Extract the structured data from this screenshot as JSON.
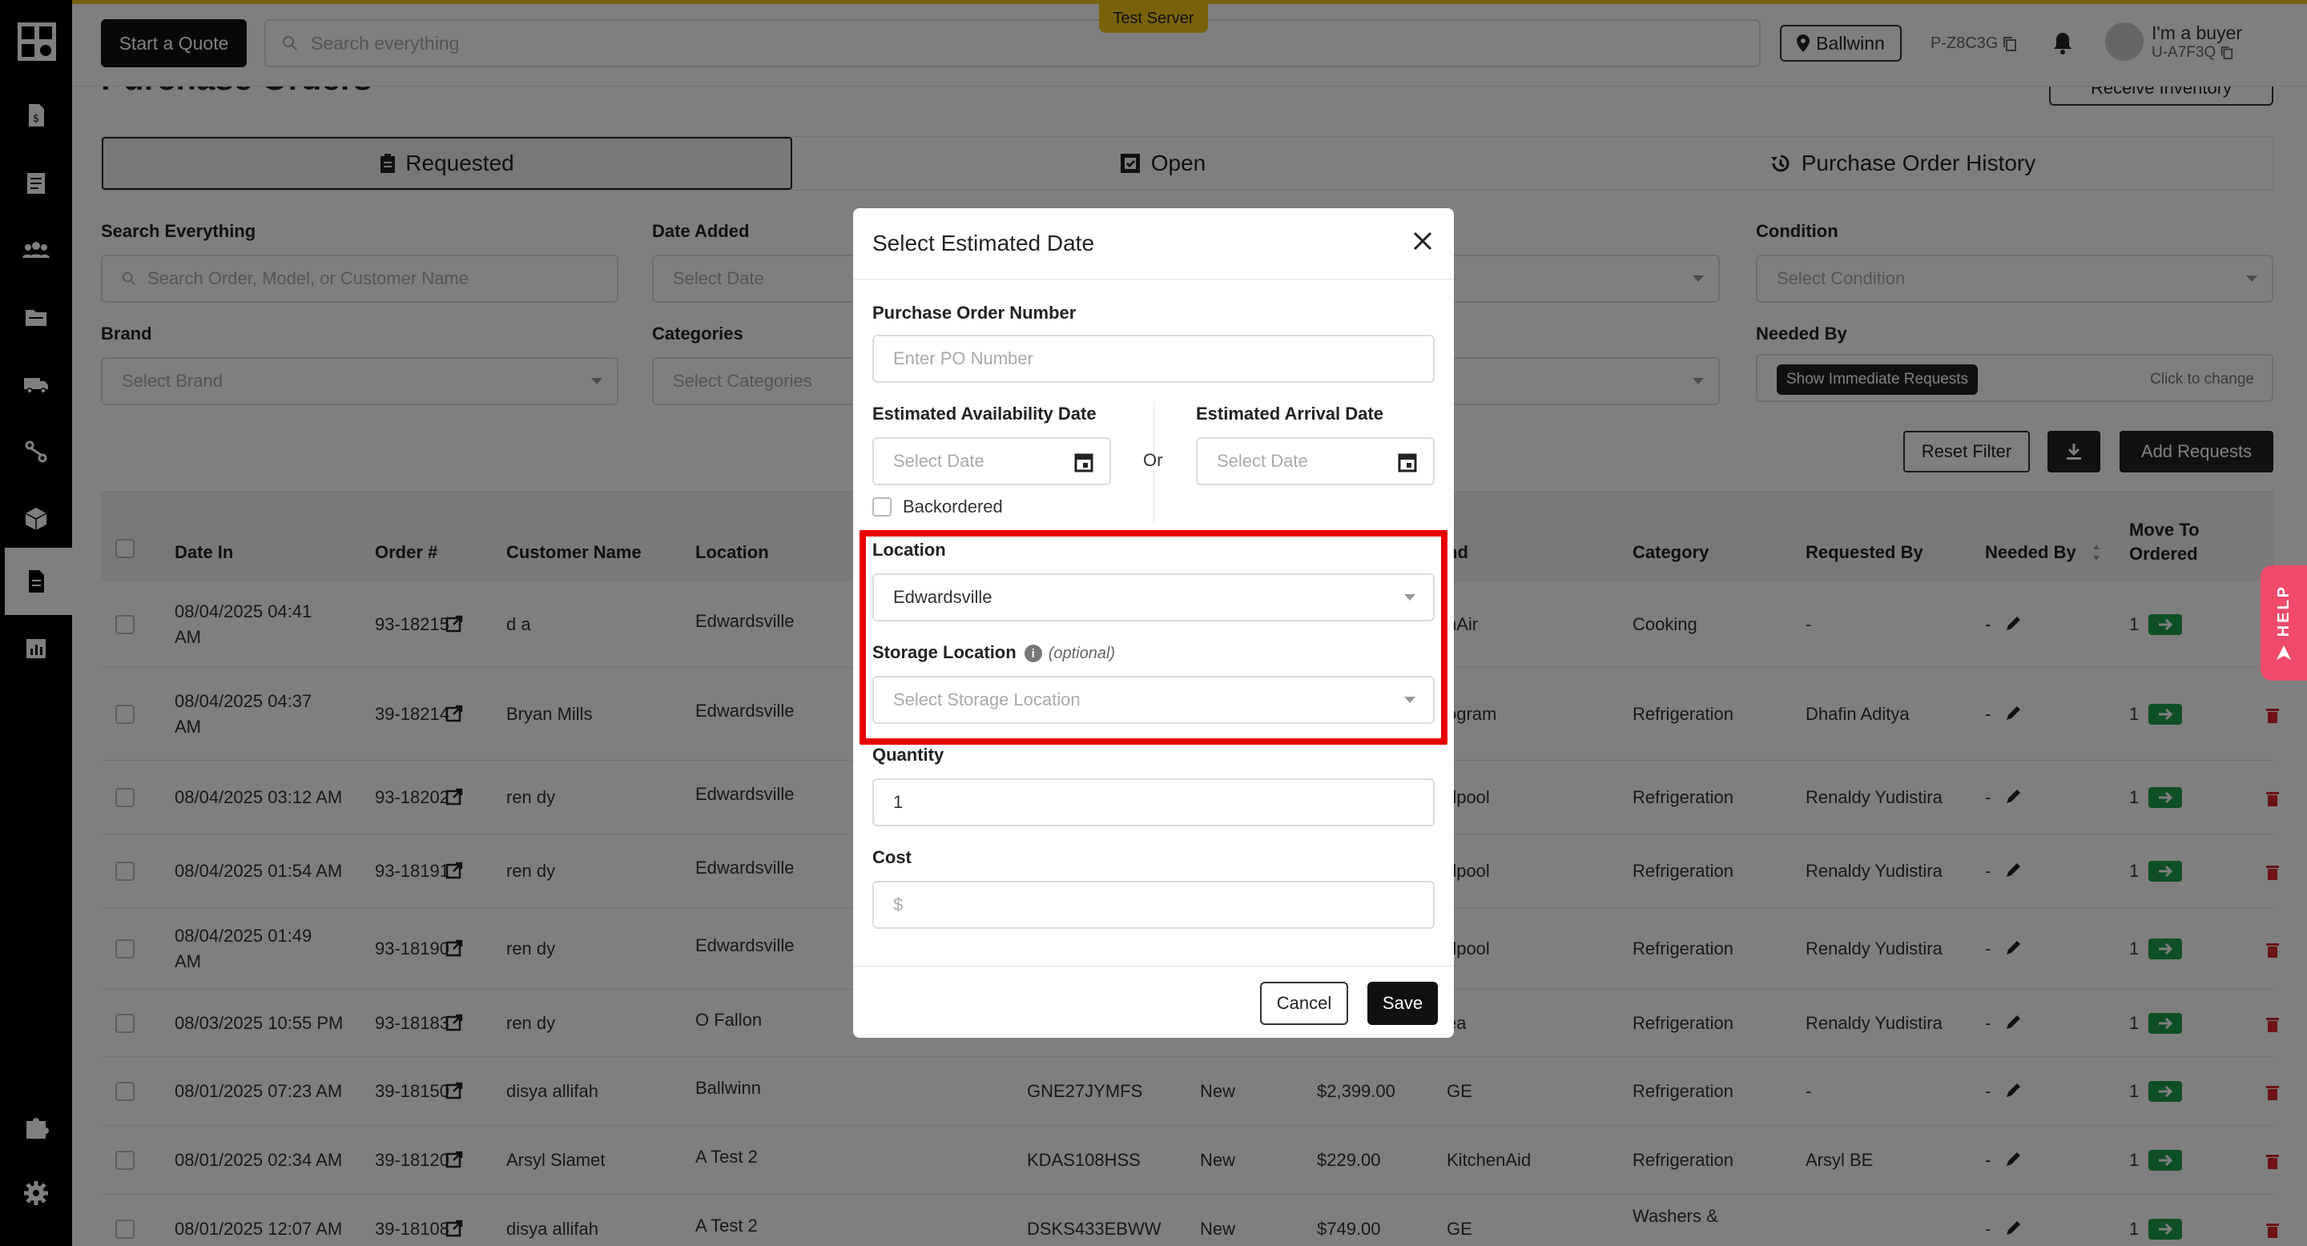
{
  "topbar": {
    "quote_label": "Start a Quote",
    "search_placeholder": "Search everything",
    "server_badge": "Test Server",
    "location": "Ballwinn",
    "partner_id": "P-Z8C3G",
    "user_name": "I'm a buyer",
    "user_id": "U-A7F3Q"
  },
  "page": {
    "title": "Purchase Orders",
    "receive_label": "Receive Inventory",
    "tabs": [
      {
        "label": "Requested",
        "icon": "clipboard-icon"
      },
      {
        "label": "Open",
        "icon": "box-icon"
      },
      {
        "label": "Purchase Order History",
        "icon": "history-icon"
      }
    ]
  },
  "filters": {
    "search_label": "Search Everything",
    "search_placeholder": "Search Order, Model, or Customer Name",
    "date_label": "Date Added",
    "date_placeholder": "Select Date",
    "condition_label": "Condition",
    "condition_placeholder": "Select Condition",
    "brand_label": "Brand",
    "brand_placeholder": "Select Brand",
    "categories_label": "Categories",
    "categories_placeholder": "Select Categories",
    "needed_label": "Needed By",
    "immediate_label": "Show Immediate Requests",
    "click_change": "Click to change",
    "reset_label": "Reset Filter",
    "add_label": "Add Requests"
  },
  "table": {
    "headers": {
      "date_in": "Date In",
      "order": "Order #",
      "customer": "Customer Name",
      "location": "Location",
      "brand": "nd",
      "category": "Category",
      "requested_by": "Requested By",
      "needed_by": "Needed By",
      "move_to": "Move To",
      "ordered": "Ordered"
    },
    "rows": [
      {
        "date1": "08/04/2025 04:41",
        "date2": "AM",
        "order": "93-18215",
        "customer": "d a",
        "location": "Edwardsville",
        "model": "",
        "condition": "",
        "price": "",
        "brand": "nAir",
        "category": "Cooking",
        "requested_by": "-",
        "needed": "-",
        "qty": "1"
      },
      {
        "date1": "08/04/2025 04:37",
        "date2": "AM",
        "order": "39-18214",
        "customer": "Bryan Mills",
        "location": "Edwardsville",
        "model": "",
        "condition": "",
        "price": "",
        "brand": "ogram",
        "category": "Refrigeration",
        "requested_by": "Dhafin Aditya",
        "needed": "-",
        "qty": "1"
      },
      {
        "date1": "08/04/2025 03:12 AM",
        "date2": "",
        "order": "93-18202",
        "customer": "ren dy",
        "location": "Edwardsville",
        "model": "",
        "condition": "",
        "price": "",
        "brand": "rlpool",
        "category": "Refrigeration",
        "requested_by": "Renaldy Yudistira",
        "needed": "-",
        "qty": "1"
      },
      {
        "date1": "08/04/2025 01:54 AM",
        "date2": "",
        "order": "93-18191",
        "customer": "ren dy",
        "location": "Edwardsville",
        "model": "",
        "condition": "",
        "price": "",
        "brand": "rlpool",
        "category": "Refrigeration",
        "requested_by": "Renaldy Yudistira",
        "needed": "-",
        "qty": "1"
      },
      {
        "date1": "08/04/2025 01:49",
        "date2": "AM",
        "order": "93-18190",
        "customer": "ren dy",
        "location": "Edwardsville",
        "model": "",
        "condition": "",
        "price": "",
        "brand": "rlpool",
        "category": "Refrigeration",
        "requested_by": "Renaldy Yudistira",
        "needed": "-",
        "qty": "1"
      },
      {
        "date1": "08/03/2025 10:55 PM",
        "date2": "",
        "order": "93-18183",
        "customer": "ren dy",
        "location": "O Fallon",
        "model": "",
        "condition": "",
        "price": "",
        "brand": "ea",
        "category": "Refrigeration",
        "requested_by": "Renaldy Yudistira",
        "needed": "-",
        "qty": "1"
      },
      {
        "date1": "08/01/2025 07:23 AM",
        "date2": "",
        "order": "39-18150",
        "customer": "disya allifah",
        "location": "Ballwinn",
        "model": "GNE27JYMFS",
        "condition": "New",
        "price": "$2,399.00",
        "brand": "GE",
        "category": "Refrigeration",
        "requested_by": "-",
        "needed": "-",
        "qty": "1"
      },
      {
        "date1": "08/01/2025 02:34 AM",
        "date2": "",
        "order": "39-18120",
        "customer": "Arsyl Slamet",
        "location": "A Test 2",
        "model": "KDAS108HSS",
        "condition": "New",
        "price": "$229.00",
        "brand": "KitchenAid",
        "category": "Refrigeration",
        "requested_by": "Arsyl BE",
        "needed": "-",
        "qty": "1"
      },
      {
        "date1": "08/01/2025 12:07 AM",
        "date2": "",
        "order": "39-18108",
        "customer": "disya allifah",
        "location": "A Test 2",
        "model": "DSKS433EBWW",
        "condition": "New",
        "price": "$749.00",
        "brand": "GE",
        "category": "Washers &",
        "requested_by": "",
        "needed": "-",
        "qty": "1"
      }
    ]
  },
  "modal": {
    "title": "Select Estimated Date",
    "po_label": "Purchase Order Number",
    "po_placeholder": "Enter PO Number",
    "avail_label": "Estimated Availability Date",
    "arrival_label": "Estimated Arrival Date",
    "date_placeholder": "Select Date",
    "or_text": "Or",
    "backordered_label": "Backordered",
    "location_label": "Location",
    "location_value": "Edwardsville",
    "storage_label": "Storage Location",
    "storage_optional": "(optional)",
    "storage_placeholder": "Select Storage Location",
    "quantity_label": "Quantity",
    "quantity_value": "1",
    "cost_label": "Cost",
    "cost_placeholder": "$",
    "cancel_label": "Cancel",
    "save_label": "Save"
  },
  "help_label": "HELP",
  "colors": {
    "accent_yellow": "#f5c518",
    "highlight_red": "#e60000",
    "move_green": "#1e9e4a",
    "help_pink": "#ef4a6a",
    "trash_red": "#d9262c"
  }
}
